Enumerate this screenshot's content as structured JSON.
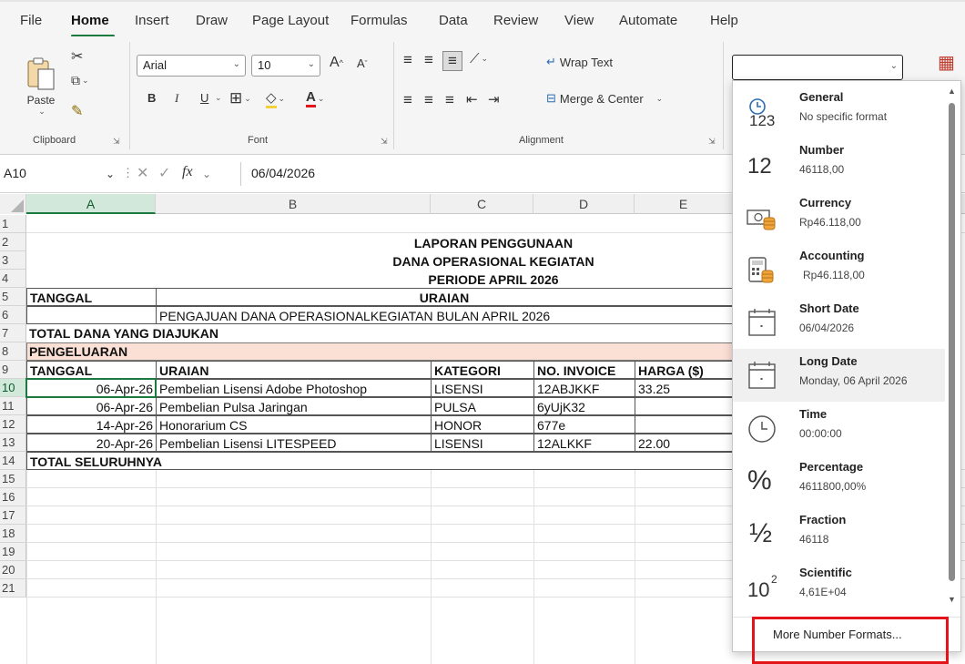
{
  "menu": {
    "items": [
      "File",
      "Home",
      "Insert",
      "Draw",
      "Page Layout",
      "Formulas",
      "Data",
      "Review",
      "View",
      "Automate",
      "Help"
    ],
    "active": "Home"
  },
  "ribbon": {
    "clipboard": {
      "paste_label": "Paste",
      "group_label": "Clipboard"
    },
    "font": {
      "name": "Arial",
      "size": "10",
      "bold": "B",
      "italic": "I",
      "underline": "U",
      "grow": "A",
      "shrink": "A",
      "group_label": "Font"
    },
    "alignment": {
      "wrap_text": "Wrap Text",
      "merge_center": "Merge & Center",
      "group_label": "Alignment"
    },
    "number_format_value": ""
  },
  "formula_bar": {
    "name_box": "A10",
    "fx": "fx",
    "value": "06/04/2026"
  },
  "sheet": {
    "columns": [
      "A",
      "B",
      "C",
      "D",
      "E"
    ],
    "rows": [
      "1",
      "2",
      "3",
      "4",
      "5",
      "6",
      "7",
      "8",
      "9",
      "10",
      "11",
      "12",
      "13",
      "14",
      "15",
      "16",
      "17",
      "18",
      "19",
      "20",
      "21"
    ],
    "title1": "LAPORAN PENGGUNAAN",
    "title2": "DANA OPERASIONAL KEGIATAN",
    "title3": "PERIODE APRIL 2026",
    "hdr_tanggal": "TANGGAL",
    "hdr_uraian": "URAIAN",
    "pengajuan": "PENGAJUAN DANA OPERASIONALKEGIATAN BULAN APRIL 2026",
    "total_diajukan": "TOTAL DANA YANG DIAJUKAN",
    "pengeluaran": "PENGELUARAN",
    "table_headers": [
      "TANGGAL",
      "URAIAN",
      "KATEGORI",
      "NO. INVOICE",
      "HARGA ($)"
    ],
    "table_rows": [
      [
        "06-Apr-26",
        "Pembelian Lisensi Adobe Photoshop",
        "LISENSI",
        "12ABJKKF",
        "33.25"
      ],
      [
        "06-Apr-26",
        "Pembelian Pulsa Jaringan",
        "PULSA",
        "6yUjK32",
        ""
      ],
      [
        "14-Apr-26",
        "Honorarium CS",
        "HONOR",
        "677e",
        ""
      ],
      [
        "20-Apr-26",
        "Pembelian Lisensi LITESPEED",
        "LISENSI",
        "12ALKKF",
        "22.00"
      ]
    ],
    "total_seluruhnya": "TOTAL SELURUHNYA"
  },
  "number_formats": [
    {
      "name": "General",
      "sample": "No specific format",
      "icon": "general-123-icon"
    },
    {
      "name": "Number",
      "sample": "46118,00",
      "icon": "number-12-icon"
    },
    {
      "name": "Currency",
      "sample": "Rp46.118,00",
      "icon": "currency-icon"
    },
    {
      "name": "Accounting",
      "sample": "Rp46.118,00",
      "icon": "accounting-icon"
    },
    {
      "name": "Short Date",
      "sample": "06/04/2026",
      "icon": "calendar-icon"
    },
    {
      "name": "Long Date",
      "sample": "Monday, 06 April 2026",
      "icon": "calendar-icon"
    },
    {
      "name": "Time",
      "sample": "00:00:00",
      "icon": "clock-icon"
    },
    {
      "name": "Percentage",
      "sample": "4611800,00%",
      "icon": "percent-icon"
    },
    {
      "name": "Fraction",
      "sample": "46118",
      "icon": "fraction-icon"
    },
    {
      "name": "Scientific",
      "sample": "4,61E+04",
      "icon": "scientific-icon"
    }
  ],
  "icon_glyphs": {
    "general": "123",
    "number": "12",
    "percent": "%",
    "fraction": "½",
    "scientific_base": "10",
    "scientific_exp": "2"
  },
  "more_formats": "More Number Formats...",
  "colors": {
    "accent": "#1b7a3e",
    "highlight": "#e3141a",
    "pink_row": "#fbe0d6"
  }
}
